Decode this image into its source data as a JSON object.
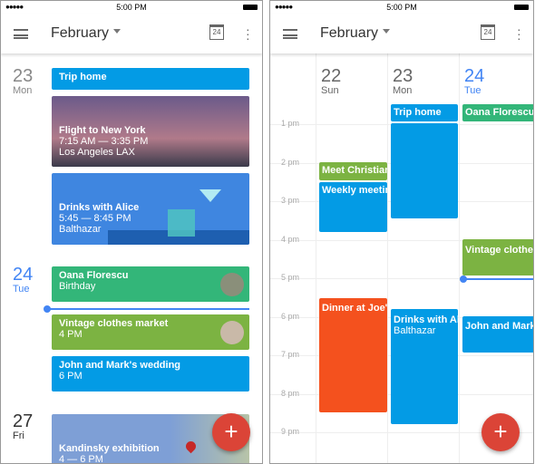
{
  "status": {
    "time": "5:00 PM",
    "signal": "●●●●●"
  },
  "header": {
    "title": "February",
    "calendar_day": "24"
  },
  "schedule": {
    "days": [
      {
        "num": "23",
        "wd": "Mon"
      },
      {
        "num": "24",
        "wd": "Tue"
      },
      {
        "num": "27",
        "wd": "Fri"
      }
    ],
    "events": [
      {
        "title": "Trip home"
      },
      {
        "title": "Flight to New York",
        "line1": "7:15 AM — 3:35 PM",
        "line2": "Los Angeles LAX"
      },
      {
        "title": "Drinks with Alice",
        "line1": "5:45 — 8:45 PM",
        "line2": "Balthazar"
      },
      {
        "title": "Oana Florescu",
        "line1": "Birthday"
      },
      {
        "title": "Vintage clothes market",
        "line1": "4 PM"
      },
      {
        "title": "John and Mark's wedding",
        "line1": "6 PM"
      },
      {
        "title": "Kandinsky exhibition",
        "line1": "4 — 6 PM"
      }
    ]
  },
  "week": {
    "days": [
      {
        "num": "22",
        "wd": "Sun"
      },
      {
        "num": "23",
        "wd": "Mon"
      },
      {
        "num": "24",
        "wd": "Tue"
      }
    ],
    "hours": [
      "1 pm",
      "2 pm",
      "3 pm",
      "4 pm",
      "5 pm",
      "6 pm",
      "7 pm",
      "8 pm",
      "9 pm"
    ],
    "events": [
      {
        "title": "Trip home"
      },
      {
        "title": "Oana Florescu's birthday"
      },
      {
        "title": "Meet Christian"
      },
      {
        "title": "Weekly meeting"
      },
      {
        "title": "Vintage clothes market"
      },
      {
        "title": "Dinner at Joe's"
      },
      {
        "title": "Drinks with Alice",
        "line1": "Balthazar"
      },
      {
        "title": "John and Mark's wedding"
      }
    ]
  },
  "fab": {
    "label": "+"
  },
  "colors": {
    "blue": "#039be5",
    "green": "#33b679",
    "lime": "#7cb342",
    "orange": "#f4511e",
    "fab": "#db4437",
    "today": "#4285f4"
  }
}
